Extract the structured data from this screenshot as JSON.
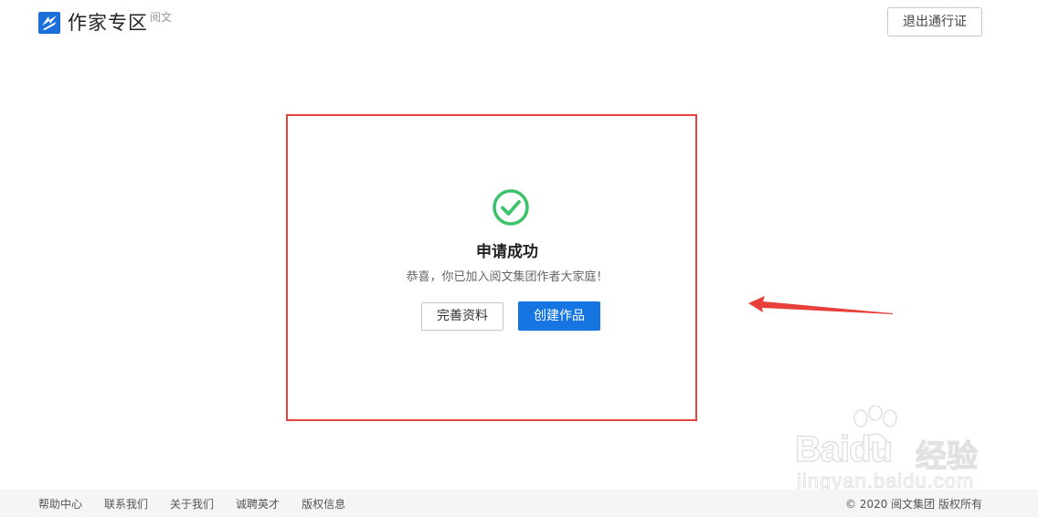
{
  "header": {
    "logo_text": "作家专区",
    "logo_sub": "阅文",
    "logout_label": "退出通行证"
  },
  "main": {
    "title": "申请成功",
    "subtitle": "恭喜，你已加入阅文集团作者大家庭！",
    "complete_profile_label": "完善资料",
    "create_work_label": "创建作品"
  },
  "footer": {
    "links": [
      "帮助中心",
      "联系我们",
      "关于我们",
      "诚聘英才",
      "版权信息"
    ],
    "copyright": "© 2020 阅文集团 版权所有"
  },
  "watermark": {
    "brand": "Baidu",
    "cn": "经验",
    "url": "jingyan.baidu.com"
  },
  "colors": {
    "accent": "#1675e0",
    "success": "#3cc26a",
    "annotation": "#e8413c"
  }
}
